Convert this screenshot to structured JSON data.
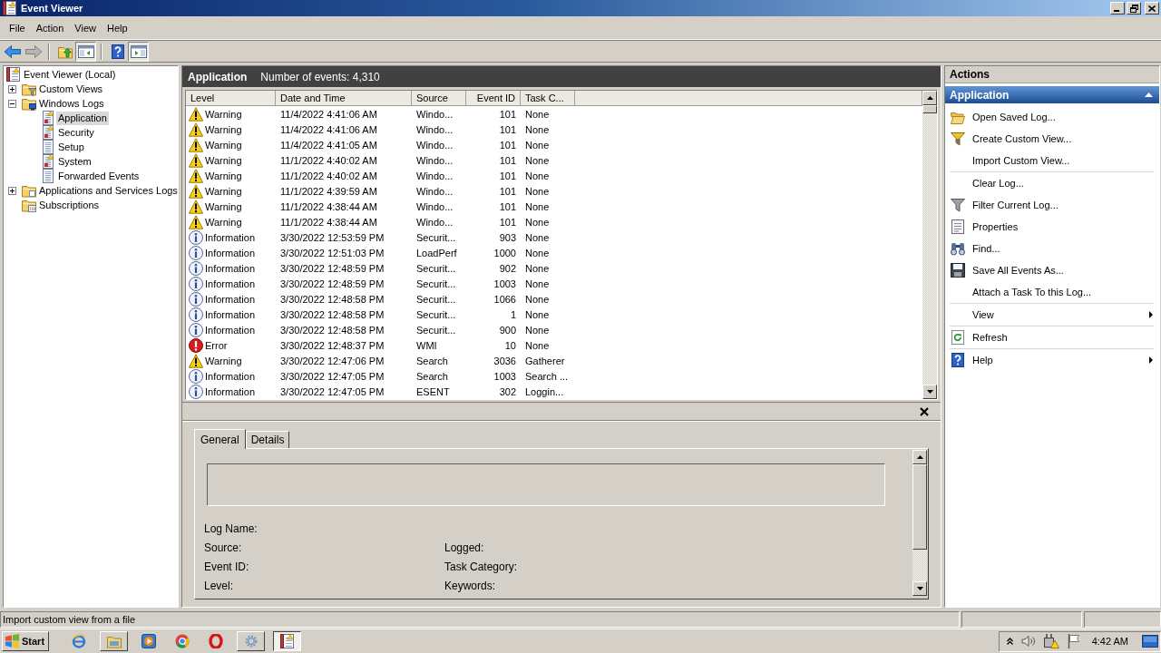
{
  "window": {
    "title": "Event Viewer"
  },
  "menu": [
    {
      "label": "File"
    },
    {
      "label": "Action"
    },
    {
      "label": "View"
    },
    {
      "label": "Help"
    }
  ],
  "toolbar": [
    [
      {
        "kind": "back",
        "disabled": false,
        "pressed": false
      },
      {
        "kind": "forward",
        "disabled": true,
        "pressed": false
      }
    ],
    [
      {
        "kind": "up",
        "disabled": false,
        "pressed": false
      },
      {
        "kind": "tree-pane",
        "disabled": false,
        "pressed": true
      }
    ],
    [
      {
        "kind": "help",
        "disabled": false,
        "pressed": false
      },
      {
        "kind": "action-pane",
        "disabled": false,
        "pressed": true
      }
    ]
  ],
  "tree": [
    {
      "label": "Event Viewer (Local)",
      "kind": "root",
      "selected": false,
      "children": [
        {
          "label": "Custom Views",
          "kind": "custom-views",
          "expanded": false,
          "selected": false
        },
        {
          "label": "Windows Logs",
          "kind": "windows-logs",
          "expanded": true,
          "selected": false,
          "children": [
            {
              "label": "Application",
              "kind": "log-marked",
              "selected": true
            },
            {
              "label": "Security",
              "kind": "log-marked",
              "selected": false
            },
            {
              "label": "Setup",
              "kind": "log",
              "selected": false
            },
            {
              "label": "System",
              "kind": "log-marked",
              "selected": false
            },
            {
              "label": "Forwarded Events",
              "kind": "log",
              "selected": false
            }
          ]
        },
        {
          "label": "Applications and Services Logs",
          "kind": "folder",
          "expanded": false,
          "selected": false
        },
        {
          "label": "Subscriptions",
          "kind": "subscriptions",
          "selected": false
        }
      ]
    }
  ],
  "events": {
    "title": "Application",
    "count": "Number of events: 4,310",
    "columns": [
      "Level",
      "Date and Time",
      "Source",
      "Event ID",
      "Task C..."
    ],
    "rows": [
      {
        "kind": "warning",
        "level": "Warning",
        "date_and_time": "11/4/2022 4:41:06 AM",
        "source": "Windo...",
        "event_id": "101",
        "task_category": "None"
      },
      {
        "kind": "warning",
        "level": "Warning",
        "date_and_time": "11/4/2022 4:41:06 AM",
        "source": "Windo...",
        "event_id": "101",
        "task_category": "None"
      },
      {
        "kind": "warning",
        "level": "Warning",
        "date_and_time": "11/4/2022 4:41:05 AM",
        "source": "Windo...",
        "event_id": "101",
        "task_category": "None"
      },
      {
        "kind": "warning",
        "level": "Warning",
        "date_and_time": "11/1/2022 4:40:02 AM",
        "source": "Windo...",
        "event_id": "101",
        "task_category": "None"
      },
      {
        "kind": "warning",
        "level": "Warning",
        "date_and_time": "11/1/2022 4:40:02 AM",
        "source": "Windo...",
        "event_id": "101",
        "task_category": "None"
      },
      {
        "kind": "warning",
        "level": "Warning",
        "date_and_time": "11/1/2022 4:39:59 AM",
        "source": "Windo...",
        "event_id": "101",
        "task_category": "None"
      },
      {
        "kind": "warning",
        "level": "Warning",
        "date_and_time": "11/1/2022 4:38:44 AM",
        "source": "Windo...",
        "event_id": "101",
        "task_category": "None"
      },
      {
        "kind": "warning",
        "level": "Warning",
        "date_and_time": "11/1/2022 4:38:44 AM",
        "source": "Windo...",
        "event_id": "101",
        "task_category": "None"
      },
      {
        "kind": "information",
        "level": "Information",
        "date_and_time": "3/30/2022 12:53:59 PM",
        "source": "Securit...",
        "event_id": "903",
        "task_category": "None"
      },
      {
        "kind": "information",
        "level": "Information",
        "date_and_time": "3/30/2022 12:51:03 PM",
        "source": "LoadPerf",
        "event_id": "1000",
        "task_category": "None"
      },
      {
        "kind": "information",
        "level": "Information",
        "date_and_time": "3/30/2022 12:48:59 PM",
        "source": "Securit...",
        "event_id": "902",
        "task_category": "None"
      },
      {
        "kind": "information",
        "level": "Information",
        "date_and_time": "3/30/2022 12:48:59 PM",
        "source": "Securit...",
        "event_id": "1003",
        "task_category": "None"
      },
      {
        "kind": "information",
        "level": "Information",
        "date_and_time": "3/30/2022 12:48:58 PM",
        "source": "Securit...",
        "event_id": "1066",
        "task_category": "None"
      },
      {
        "kind": "information",
        "level": "Information",
        "date_and_time": "3/30/2022 12:48:58 PM",
        "source": "Securit...",
        "event_id": "1",
        "task_category": "None"
      },
      {
        "kind": "information",
        "level": "Information",
        "date_and_time": "3/30/2022 12:48:58 PM",
        "source": "Securit...",
        "event_id": "900",
        "task_category": "None"
      },
      {
        "kind": "error",
        "level": "Error",
        "date_and_time": "3/30/2022 12:48:37 PM",
        "source": "WMI",
        "event_id": "10",
        "task_category": "None"
      },
      {
        "kind": "warning",
        "level": "Warning",
        "date_and_time": "3/30/2022 12:47:06 PM",
        "source": "Search",
        "event_id": "3036",
        "task_category": "Gatherer"
      },
      {
        "kind": "information",
        "level": "Information",
        "date_and_time": "3/30/2022 12:47:05 PM",
        "source": "Search",
        "event_id": "1003",
        "task_category": "Search ..."
      },
      {
        "kind": "information",
        "level": "Information",
        "date_and_time": "3/30/2022 12:47:05 PM",
        "source": "ESENT",
        "event_id": "302",
        "task_category": "Loggin..."
      }
    ]
  },
  "details": {
    "tabs": [
      {
        "label": "General",
        "selected": true
      },
      {
        "label": "Details",
        "selected": false
      }
    ],
    "fields": [
      {
        "left": "Log Name:"
      },
      {
        "left": "Source:",
        "right": "Logged:"
      },
      {
        "left": "Event ID:",
        "right": "Task Category:"
      },
      {
        "left": "Level:",
        "right": "Keywords:"
      }
    ]
  },
  "actions": {
    "title": "Actions",
    "section": {
      "title": "Application",
      "expanded": true,
      "groups": [
        [
          {
            "label": "Open Saved Log...",
            "kind": "open-saved-log",
            "submenu": false
          },
          {
            "label": "Create Custom View...",
            "kind": "create-custom-view",
            "submenu": false
          },
          {
            "label": "Import Custom View...",
            "kind": "import-custom-view",
            "submenu": false
          }
        ],
        [
          {
            "label": "Clear Log...",
            "kind": "clear-log",
            "submenu": false
          },
          {
            "label": "Filter Current Log...",
            "kind": "filter-log",
            "submenu": false
          },
          {
            "label": "Properties",
            "kind": "properties",
            "submenu": false
          },
          {
            "label": "Find...",
            "kind": "find",
            "submenu": false
          },
          {
            "label": "Save All Events As...",
            "kind": "save",
            "submenu": false
          },
          {
            "label": "Attach a Task To this Log...",
            "kind": "attach-task",
            "submenu": false
          }
        ],
        [
          {
            "label": "View",
            "kind": "view",
            "submenu": true
          }
        ],
        [
          {
            "label": "Refresh",
            "kind": "refresh",
            "submenu": false
          }
        ],
        [
          {
            "label": "Help",
            "kind": "help",
            "submenu": true
          }
        ]
      ]
    }
  },
  "status_bar": {
    "text": "Import custom view from a file"
  },
  "taskbar": {
    "start": "Start",
    "items": [
      {
        "kind": "browser-e",
        "open": false,
        "active": false
      },
      {
        "kind": "folder",
        "open": true,
        "active": false
      },
      {
        "kind": "play",
        "open": false,
        "active": false
      },
      {
        "kind": "browser-round",
        "open": false,
        "active": false
      },
      {
        "kind": "ring-o",
        "open": false,
        "active": false
      },
      {
        "kind": "gear",
        "open": true,
        "active": false
      },
      {
        "kind": "log-book",
        "open": true,
        "active": true
      }
    ],
    "clock": "4:42 AM"
  }
}
